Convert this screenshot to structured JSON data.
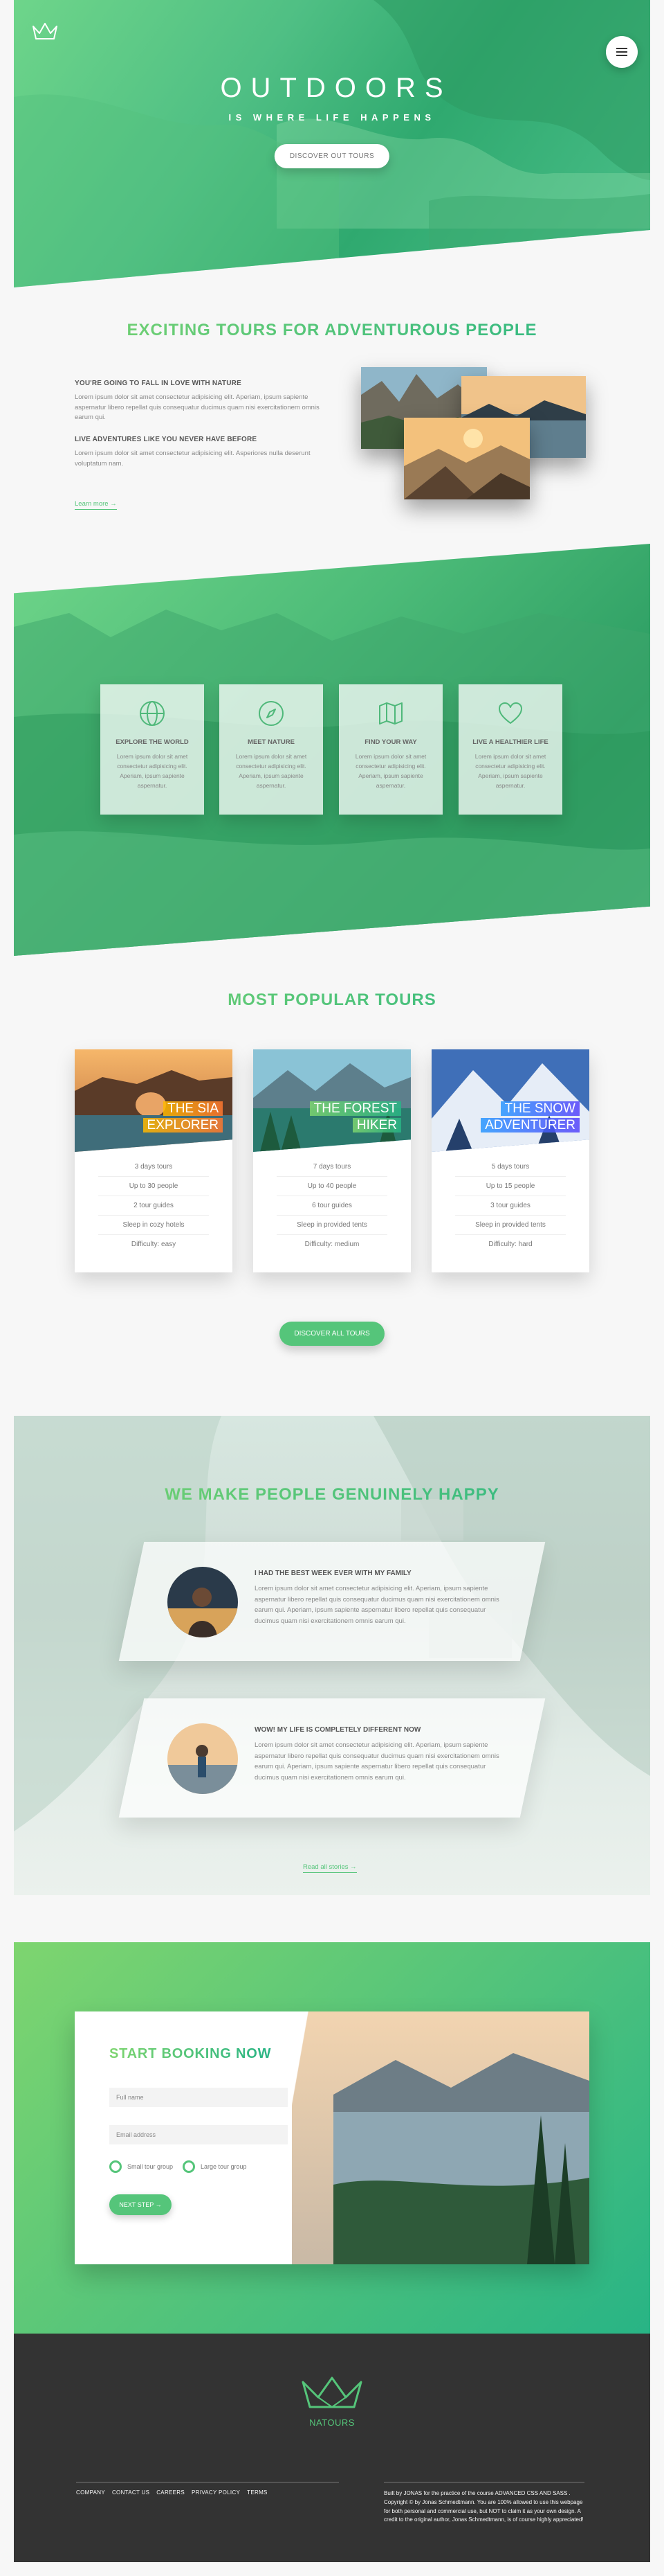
{
  "colors": {
    "primary": "#55c57a",
    "primary_light": "#7ed56f",
    "primary_dark": "#28b485",
    "footer_bg": "#333333"
  },
  "header": {
    "logo_icon": "crown-logo-icon",
    "menu_icon": "hamburger-menu-icon",
    "title_main": "OUTDOORS",
    "title_sub": "IS WHERE LIFE HAPPENS",
    "cta_label": "DISCOVER OUT TOURS"
  },
  "about": {
    "heading": "EXCITING TOURS FOR ADVENTUROUS PEOPLE",
    "p1_title": "YOU'RE GOING TO FALL IN LOVE WITH NATURE",
    "p1_text": "Lorem ipsum dolor sit amet consectetur adipisicing elit. Aperiam, ipsum sapiente aspernatur libero repellat quis consequatur ducimus quam nisi exercitationem omnis earum qui.",
    "p2_title": "LIVE ADVENTURES LIKE YOU NEVER HAVE BEFORE",
    "p2_text": "Lorem ipsum dolor sit amet consectetur adipisicing elit. Asperiores nulla deserunt voluptatum nam.",
    "link_label": "Learn more →"
  },
  "features": [
    {
      "icon": "globe-icon",
      "title": "EXPLORE THE WORLD",
      "text": "Lorem ipsum dolor sit amet consectetur adipisicing elit. Aperiam, ipsum sapiente aspernatur."
    },
    {
      "icon": "compass-icon",
      "title": "MEET NATURE",
      "text": "Lorem ipsum dolor sit amet consectetur adipisicing elit. Aperiam, ipsum sapiente aspernatur."
    },
    {
      "icon": "map-icon",
      "title": "FIND YOUR WAY",
      "text": "Lorem ipsum dolor sit amet consectetur adipisicing elit. Aperiam, ipsum sapiente aspernatur."
    },
    {
      "icon": "heart-icon",
      "title": "LIVE A HEALTHIER LIFE",
      "text": "Lorem ipsum dolor sit amet consectetur adipisicing elit. Aperiam, ipsum sapiente aspernatur."
    }
  ],
  "tours": {
    "heading": "MOST POPULAR TOURS",
    "cards": [
      {
        "title_l1": "THE SIA",
        "title_l2": "EXPLORER",
        "tag_color": "#ffb900",
        "details": [
          "3 days tours",
          "Up to 30 people",
          "2 tour guides",
          "Sleep in cozy hotels",
          "Difficulty: easy"
        ]
      },
      {
        "title_l1": "THE FOREST",
        "title_l2": "HIKER",
        "tag_color": "#7ed56f",
        "details": [
          "7 days tours",
          "Up to 40 people",
          "6 tour guides",
          "Sleep in provided tents",
          "Difficulty: medium"
        ]
      },
      {
        "title_l1": "THE SNOW",
        "title_l2": "ADVENTURER",
        "tag_color": "#2998ff",
        "details": [
          "5 days tours",
          "Up to 15 people",
          "3 tour guides",
          "Sleep in provided tents",
          "Difficulty: hard"
        ]
      }
    ],
    "cta_label": "DISCOVER ALL TOURS"
  },
  "stories": {
    "heading": "WE MAKE PEOPLE GENUINELY HAPPY",
    "items": [
      {
        "title": "I HAD THE BEST WEEK EVER WITH MY FAMILY",
        "text": "Lorem ipsum dolor sit amet consectetur adipisicing elit. Aperiam, ipsum sapiente aspernatur libero repellat quis consequatur ducimus quam nisi exercitationem omnis earum qui. Aperiam, ipsum sapiente aspernatur libero repellat quis consequatur ducimus quam nisi exercitationem omnis earum qui."
      },
      {
        "title": "WOW! MY LIFE IS COMPLETELY DIFFERENT NOW",
        "text": "Lorem ipsum dolor sit amet consectetur adipisicing elit. Aperiam, ipsum sapiente aspernatur libero repellat quis consequatur ducimus quam nisi exercitationem omnis earum qui. Aperiam, ipsum sapiente aspernatur libero repellat quis consequatur ducimus quam nisi exercitationem omnis earum qui."
      }
    ],
    "link_label": "Read all stories →"
  },
  "booking": {
    "heading": "START BOOKING NOW",
    "name_placeholder": "Full name",
    "email_placeholder": "Email address",
    "radio_small": "Small tour group",
    "radio_large": "Large tour group",
    "submit_label": "NEXT STEP →"
  },
  "footer": {
    "brand": "NATOURS",
    "links": [
      "COMPANY",
      "CONTACT US",
      "CAREERS",
      "PRIVACY POLICY",
      "TERMS"
    ],
    "copyright": "Built by  JONAS  for the practice of the course  ADVANCED CSS AND SASS . Copyright © by Jonas Schmedtmann. You are 100% allowed to use this webpage for both personal and commercial use, but NOT to claim it as your own design. A credit to the original author, Jonas Schmedtmann, is of course highly appreciated!"
  }
}
